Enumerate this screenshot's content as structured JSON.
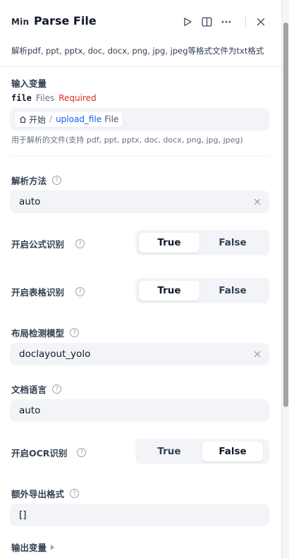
{
  "header": {
    "logo_text": "Min",
    "title": "Parse File",
    "icons": [
      "play-icon",
      "split-view-icon",
      "more-icon",
      "close-icon"
    ]
  },
  "description": "解析pdf, ppt, pptx, doc, docx, png, jpg, jpeg等格式文件为txt格式",
  "input_vars": {
    "title": "输入变量",
    "var_name": "file",
    "var_type": "Files",
    "required": "Required",
    "chip": {
      "home": "开始",
      "separator": "/",
      "var": "upload_file",
      "type": "File"
    },
    "hint": "用于解析的文件(支持 pdf, ppt, pptx, doc, docx, png, jpg, jpeg)"
  },
  "fields": {
    "parse_method": {
      "label": "解析方法",
      "value": "auto"
    },
    "formula": {
      "label": "开启公式识别",
      "true_label": "True",
      "false_label": "False",
      "selected": "True"
    },
    "table": {
      "label": "开启表格识别",
      "true_label": "True",
      "false_label": "False",
      "selected": "True"
    },
    "layout_model": {
      "label": "布局检测模型",
      "value": "doclayout_yolo"
    },
    "doc_lang": {
      "label": "文档语言",
      "value": "auto"
    },
    "ocr": {
      "label": "开启OCR识别",
      "true_label": "True",
      "false_label": "False",
      "selected": "False"
    },
    "export_formats": {
      "label": "额外导出格式",
      "value": "[]"
    }
  },
  "output_vars": {
    "title": "输出变量"
  },
  "help_glyph": "?",
  "colors": {
    "accent_blue": "#155eef",
    "required_red": "#d92d20",
    "input_bg": "#f2f4f7"
  }
}
